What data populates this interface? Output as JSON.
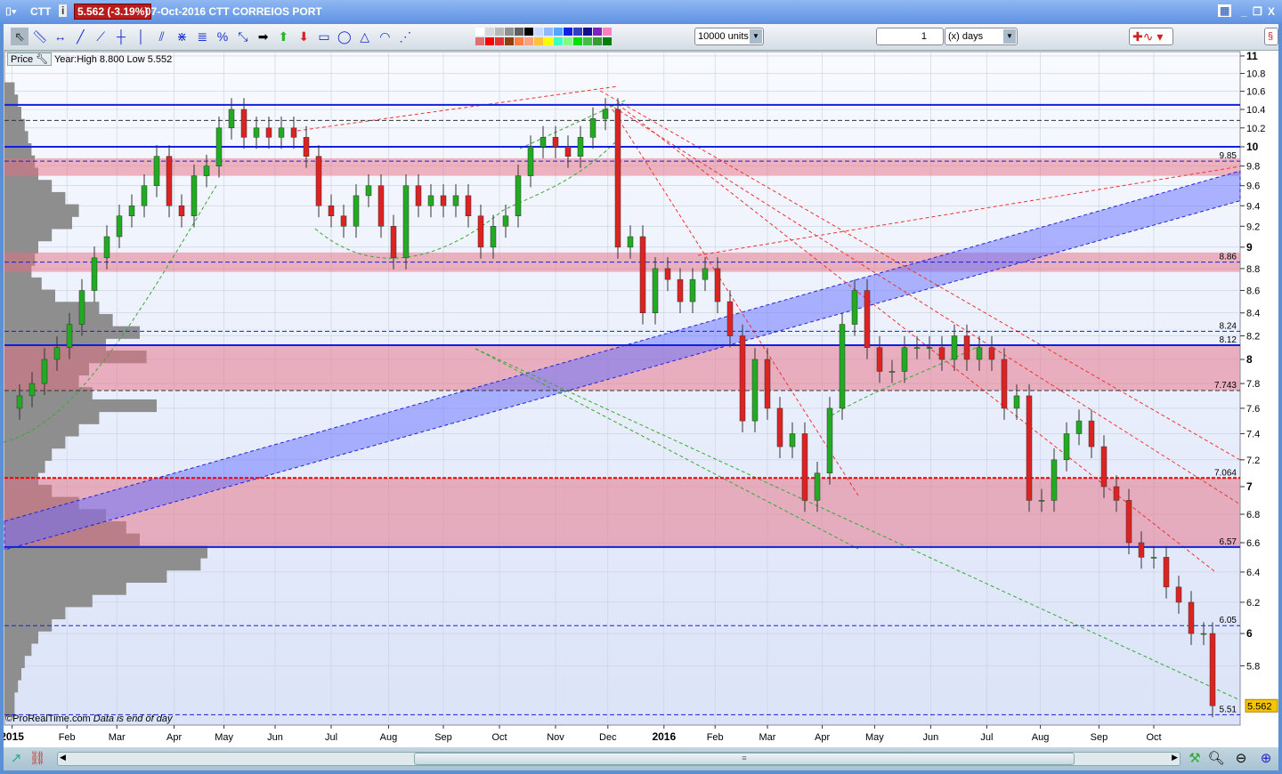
{
  "window": {
    "symbol": "CTT",
    "price_change": "5.562 (-3.19%)",
    "date_name": "07-Oct-2016 CTT CORREIOS PORT",
    "controls": [
      "_",
      "❐",
      "X"
    ]
  },
  "toolbar": {
    "units": "10000 units",
    "period_value": "1",
    "period_unit": "(x) days",
    "tools": [
      "pointer-icon",
      "ruler-icon",
      "horizontal-segment-icon",
      "line-icon",
      "segment-icon",
      "horizontal-line-icon",
      "vertical-line-icon",
      "channel-icon",
      "parallel-lines-icon",
      "fibonacci-icon",
      "percent-levels-icon",
      "point-line-icon",
      "arrow-right-icon",
      "arrow-up-icon",
      "arrow-down-icon",
      "rectangle-icon",
      "ellipse-icon",
      "triangle-icon",
      "fan-icon",
      "gann-icon"
    ],
    "swatches_top": [
      "#ffffff",
      "#d8d8d8",
      "#b8b8b8",
      "#909090",
      "#606060",
      "#000000",
      "#c8d8ff",
      "#90b8ff",
      "#50a8ff",
      "#1020e0",
      "#3040c0",
      "#101090",
      "#8020c0",
      "#ff80c0"
    ],
    "swatches_bottom": [
      "#e07070",
      "#ff0000",
      "#e03030",
      "#904010",
      "#ff8040",
      "#ffa080",
      "#ffc040",
      "#ffff00",
      "#40ffc0",
      "#80ff80",
      "#00e000",
      "#40c040",
      "#30a030",
      "#008000"
    ]
  },
  "info": {
    "price_label": "Price",
    "year_stats": "Year:High 8.800 Low 5.552"
  },
  "footer_note": {
    "copyright": "©ProRealTime.com",
    "note": "Data is end of day"
  },
  "chart_data": {
    "type": "candlestick",
    "title": "CTT CORREIOS PORT",
    "scale": "log",
    "ylim": [
      5.45,
      11.05
    ],
    "y_ticks": [
      "11",
      "10.8",
      "10.6",
      "10.4",
      "10.2",
      "10",
      "9.8",
      "9.6",
      "9.4",
      "9.2",
      "9",
      "8.8",
      "8.6",
      "8.4",
      "8.2",
      "8",
      "7.8",
      "7.6",
      "7.4",
      "7.2",
      "7",
      "6.8",
      "6.6",
      "6.4",
      "6.2",
      "6",
      "5.8"
    ],
    "y_tick_values": [
      11,
      10.8,
      10.6,
      10.4,
      10.2,
      10,
      9.8,
      9.6,
      9.4,
      9.2,
      9,
      8.8,
      8.6,
      8.4,
      8.2,
      8,
      7.8,
      7.6,
      7.4,
      7.2,
      7,
      6.8,
      6.6,
      6.4,
      6.2,
      6,
      5.8
    ],
    "bold_ticks": [
      11,
      10,
      9,
      8,
      7,
      6
    ],
    "x_ticks": [
      "2015",
      "Feb",
      "Mar",
      "Apr",
      "May",
      "Jun",
      "Jul",
      "Aug",
      "Sep",
      "Oct",
      "Nov",
      "Dec",
      "2016",
      "Feb",
      "Mar",
      "Apr",
      "May",
      "Jun",
      "Jul",
      "Aug",
      "Sep",
      "Oct"
    ],
    "x_tick_week": [
      0.4,
      4.8,
      8.8,
      13.4,
      17.4,
      21.5,
      26,
      30.6,
      35,
      39.5,
      44,
      48.2,
      52.7,
      56.8,
      61,
      65.4,
      69.6,
      74.1,
      78.6,
      82.9,
      87.6,
      92
    ],
    "weekly_close": [
      7.6,
      7.7,
      7.8,
      8.0,
      8.1,
      8.3,
      8.6,
      8.9,
      9.1,
      9.3,
      9.4,
      9.6,
      9.9,
      9.4,
      9.3,
      9.7,
      9.8,
      10.2,
      10.4,
      10.1,
      10.2,
      10.1,
      10.2,
      10.1,
      9.9,
      9.4,
      9.3,
      9.2,
      9.5,
      9.6,
      9.2,
      8.9,
      9.6,
      9.4,
      9.5,
      9.4,
      9.5,
      9.3,
      9.0,
      9.2,
      9.3,
      9.7,
      10.0,
      10.1,
      10.0,
      9.9,
      10.1,
      10.3,
      10.4,
      9.0,
      9.1,
      8.4,
      8.8,
      8.7,
      8.5,
      8.7,
      8.8,
      8.5,
      8.2,
      7.5,
      8.0,
      7.6,
      7.3,
      7.4,
      6.9,
      7.1,
      7.6,
      8.3,
      8.6,
      8.1,
      7.9,
      7.9,
      8.1,
      8.1,
      8.1,
      8.0,
      8.2,
      8.0,
      8.1,
      8.0,
      7.6,
      7.7,
      6.9,
      6.9,
      7.2,
      7.4,
      7.5,
      7.3,
      7.0,
      6.9,
      6.6,
      6.5,
      6.5,
      6.3,
      6.2,
      6.0,
      6.0,
      5.562
    ],
    "current_price": "5.562",
    "levels": [
      {
        "value": 10.45,
        "style": "solid-blue"
      },
      {
        "value": 10.28,
        "style": "dashed-black"
      },
      {
        "value": 10.0,
        "style": "solid-blue"
      },
      {
        "value": 9.85,
        "style": "dashed-blue",
        "label": "9.85"
      },
      {
        "value": 8.86,
        "style": "dashed-blue",
        "label": "8.86"
      },
      {
        "value": 8.24,
        "style": "dashed-blue",
        "label": "8.24"
      },
      {
        "value": 8.12,
        "style": "solid-blue",
        "label": "8.12"
      },
      {
        "value": 7.743,
        "style": "dashed-black",
        "label": "7.743"
      },
      {
        "value": 7.064,
        "style": "dashed-red",
        "label": "7.064"
      },
      {
        "value": 6.57,
        "style": "solid-blue",
        "label": "6.57"
      },
      {
        "value": 6.05,
        "style": "dashed-blue",
        "label": "6.05"
      },
      {
        "value": 5.51,
        "style": "dashed-blue",
        "label": "5.51"
      }
    ],
    "zones": [
      [
        9.7,
        9.88
      ],
      [
        8.77,
        8.95
      ],
      [
        7.743,
        8.12
      ],
      [
        6.57,
        7.064
      ]
    ],
    "channel": {
      "left": [
        6.55,
        6.75
      ],
      "right": [
        9.45,
        9.75
      ]
    },
    "volume_profile": [
      3,
      4,
      5,
      6,
      7,
      8,
      9,
      10,
      14,
      18,
      22,
      20,
      14,
      10,
      9,
      8,
      11,
      15,
      28,
      32,
      40,
      30,
      42,
      25,
      22,
      26,
      45,
      28,
      22,
      18,
      14,
      12,
      10,
      14,
      22,
      30,
      36,
      40,
      60,
      58,
      48,
      36,
      26,
      18,
      14,
      10,
      8,
      6,
      5,
      4,
      3,
      3
    ]
  }
}
